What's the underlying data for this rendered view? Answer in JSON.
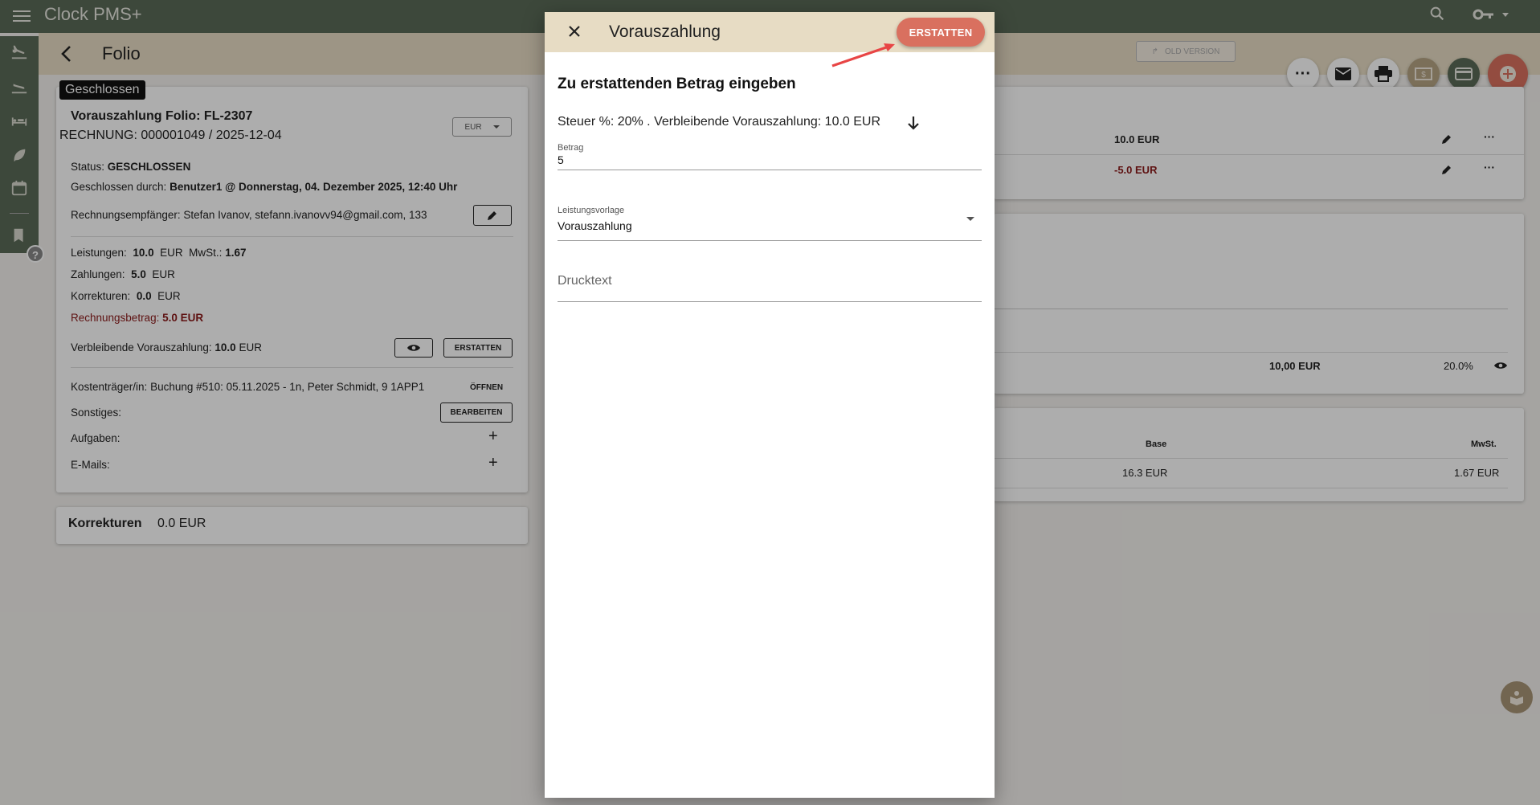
{
  "app": {
    "brand": "Clock PMS+"
  },
  "header": {
    "back_icon": "chevron-left-icon",
    "title": "Folio",
    "old_version": "OLD VERSION"
  },
  "folio": {
    "status_badge": "Geschlossen",
    "title": "Vorauszahlung Folio: FL-2307",
    "invoice_label": "RECHNUNG:",
    "invoice_value": "000001049 / 2025-12-04",
    "currency_select": "EUR",
    "status_label": "Status:",
    "status_value": "GESCHLOSSEN",
    "closed_by_label": "Geschlossen durch:",
    "closed_by_value": "Benutzer1 @ Donnerstag, 04. Dezember 2025, 12:40 Uhr",
    "recipient_label": "Rechnungsempfänger:",
    "recipient_value": "Stefan Ivanov, stefann.ivanovv94@gmail.com, 133",
    "services_label": "Leistungen:",
    "services_value": "10.0",
    "services_currency": "EUR",
    "vat_label": "MwSt.:",
    "vat_value": "1.67",
    "payments_label": "Zahlungen:",
    "payments_value": "5.0",
    "payments_currency": "EUR",
    "corrections_label": "Korrekturen:",
    "corrections_value": "0.0",
    "corrections_currency": "EUR",
    "invoice_amount_label": "Rechnungsbetrag:",
    "invoice_amount_value": "5.0 EUR",
    "remaining_label": "Verbleibende Vorauszahlung:",
    "remaining_value": "10.0",
    "remaining_currency": "EUR",
    "refund_button": "ERSTATTEN",
    "payer_label": "Kostenträger/in:",
    "payer_value": "Buchung #510: 05.11.2025 - 1n, Peter Schmidt, 9 1APP1",
    "open_button": "ÖFFNEN",
    "misc_label": "Sonstiges:",
    "edit_button": "BEARBEITEN",
    "tasks_label": "Aufgaben:",
    "emails_label": "E-Mails:",
    "add_symbol": "+"
  },
  "corrections_card": {
    "label": "Korrekturen",
    "value": "0.0 EUR"
  },
  "right_panel": {
    "row1_amount": "10.0 EUR",
    "row2_amount": "-5.0 EUR",
    "row3_amount": "10,00 EUR",
    "row3_percent": "20.0%",
    "col_base": "Base",
    "col_vat": "MwSt.",
    "base_value": "16.3 EUR",
    "vat_value": "1.67 EUR",
    "more_dots": "···"
  },
  "dialog": {
    "title": "Vorauszahlung",
    "refund_button": "ERSTATTEN",
    "subtitle": "Zu erstattenden Betrag eingeben",
    "info": "Steuer %: 20% . Verbleibende Vorauszahlung: 10.0 EUR",
    "amount_label": "Betrag",
    "amount_value": "5",
    "template_label": "Leistungsvorlage",
    "template_value": "Vorauszahlung",
    "print_text_placeholder": "Drucktext"
  },
  "colors": {
    "topbar": "#5a6a57",
    "header": "#e7dcc4",
    "accent": "#d9705f",
    "negative": "#8b1a1a"
  }
}
